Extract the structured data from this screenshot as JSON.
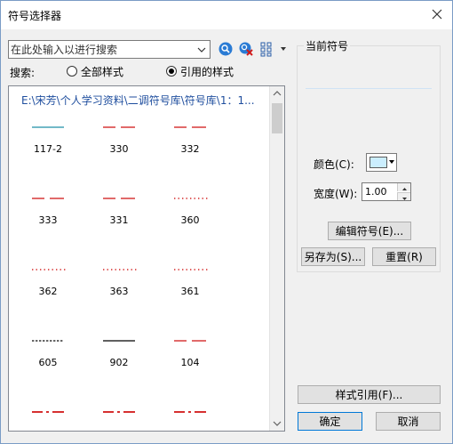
{
  "window": {
    "title": "符号选择器"
  },
  "search": {
    "placeholder": "在此处输入以进行搜索",
    "label": "搜索:"
  },
  "radios": [
    {
      "label": "全部样式",
      "selected": false
    },
    {
      "label": "引用的样式",
      "selected": true
    }
  ],
  "list": {
    "path": "E:\\宋芳\\个人学习资料\\二调符号库\\符号库\\1：1...",
    "items": [
      {
        "label": "117-2",
        "style": "solid",
        "color": "#1f8fa6"
      },
      {
        "label": "330",
        "style": "dash",
        "color": "#d11a1a"
      },
      {
        "label": "332",
        "style": "dash",
        "color": "#d11a1a"
      },
      {
        "label": "333",
        "style": "dash",
        "color": "#d11a1a"
      },
      {
        "label": "331",
        "style": "dash",
        "color": "#d11a1a"
      },
      {
        "label": "360",
        "style": "dot",
        "color": "#d11a1a"
      },
      {
        "label": "362",
        "style": "dot",
        "color": "#d11a1a"
      },
      {
        "label": "363",
        "style": "dot",
        "color": "#d11a1a"
      },
      {
        "label": "361",
        "style": "dot",
        "color": "#d11a1a"
      },
      {
        "label": "605",
        "style": "dash-fine",
        "color": "#000000"
      },
      {
        "label": "902",
        "style": "solid",
        "color": "#000000"
      },
      {
        "label": "104",
        "style": "dash",
        "color": "#d11a1a"
      },
      {
        "label": "",
        "style": "dashdot",
        "color": "#d11a1a"
      },
      {
        "label": "",
        "style": "dashdot",
        "color": "#d11a1a"
      },
      {
        "label": "",
        "style": "dashdot",
        "color": "#d11a1a"
      }
    ]
  },
  "current_symbol": {
    "title": "当前符号",
    "preview_color": "#cfe3f5"
  },
  "color": {
    "label": "颜色(C):",
    "value": "#cbeefe"
  },
  "width": {
    "label": "宽度(W):",
    "value": "1.00"
  },
  "buttons": {
    "edit_symbol": "编辑符号(E)...",
    "save_as": "另存为(S)...",
    "reset": "重置(R)",
    "style_ref": "样式引用(F)...",
    "ok": "确定",
    "cancel": "取消"
  },
  "icons": {
    "search": "search-icon",
    "clear_search": "clear-search-icon",
    "view_mode": "grid-view-icon",
    "close": "close-icon"
  }
}
